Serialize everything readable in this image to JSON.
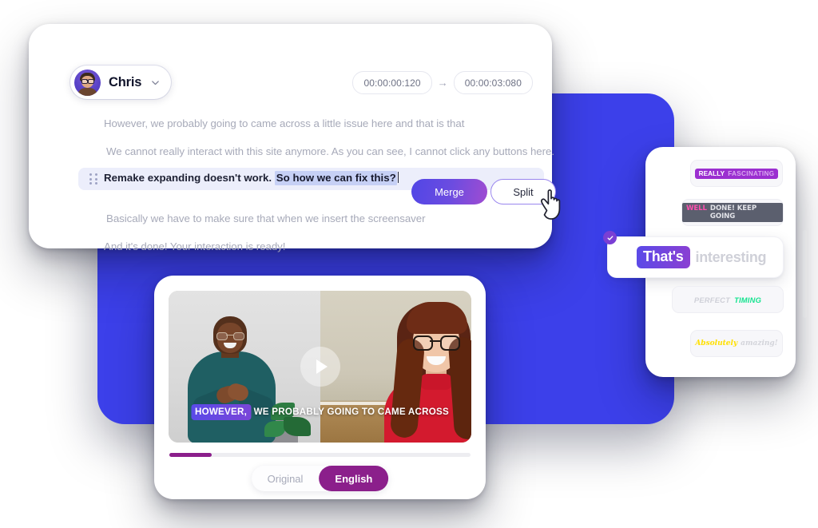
{
  "colors": {
    "blue_panel": "#3c40ea",
    "accent_purple": "#7a3fd4",
    "merge_gradient_start": "#5146e6",
    "merge_gradient_end": "#a04cd1",
    "english_magenta": "#8b1f8b",
    "selection_highlight": "#c6d0f5",
    "active_row": "#eceefb"
  },
  "transcript": {
    "speaker": {
      "name": "Chris",
      "avatar_icon": "user-avatar",
      "caret_icon": "chevron-down-icon"
    },
    "timecode": {
      "start": "00:00:00:120",
      "arrow": "→",
      "end": "00:00:03:080"
    },
    "lines": [
      {
        "text": "However, we probably going to came across a little issue here and that is that",
        "active": false
      },
      {
        "text": "We cannot really interact with this site anymore. As you can see, I cannot click any buttons here.",
        "active": false
      }
    ],
    "active_line": {
      "plain": "Remake expanding doesn't work.",
      "selected": "So how we can fix this?",
      "handle_icon": "drag-handle-icon"
    },
    "lines_after": [
      {
        "text": "Basically we have to make sure that when we insert the screensaver"
      },
      {
        "text": "And it's done! Your interaction is ready!"
      }
    ],
    "actions": {
      "merge_label": "Merge",
      "split_label": "Split",
      "cursor_icon": "hand-pointer-icon"
    }
  },
  "video": {
    "play_icon": "play-icon",
    "caption": {
      "highlighted": "HOWEVER,",
      "rest": "WE PROBABLY GOING TO CAME ACROSS"
    },
    "progress_percent": 14,
    "language_tabs": [
      {
        "label": "Original",
        "active": false
      },
      {
        "label": "English",
        "active": true
      }
    ]
  },
  "presets": {
    "check_icon": "check-icon",
    "items": [
      {
        "part_a": "REALLY",
        "part_b": "FASCINATING",
        "selected": false
      },
      {
        "part_a": "WELL",
        "part_b": "DONE! KEEP GOING",
        "selected": false
      },
      {
        "part_a": "That's",
        "part_b": "interesting",
        "selected": true
      },
      {
        "part_a": "PERFECT",
        "part_b": "TIMING",
        "selected": false
      },
      {
        "part_a": "Absolutely",
        "part_b": "amazing!",
        "selected": false
      }
    ]
  }
}
